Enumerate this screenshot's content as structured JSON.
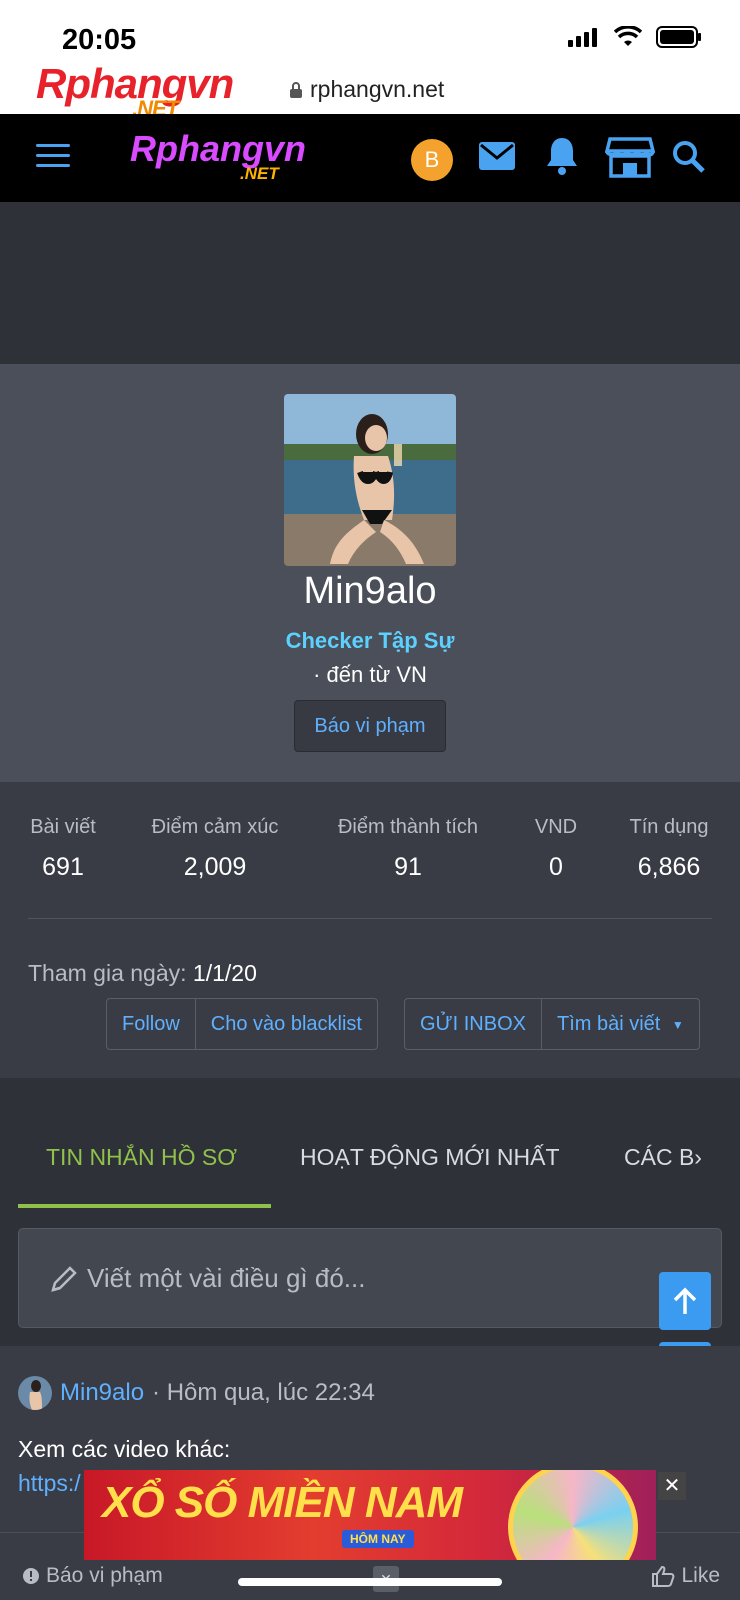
{
  "status_bar": {
    "time": "20:05"
  },
  "browser": {
    "site_logo": "Rphangvn",
    "site_logo_suffix": ".NET",
    "url": "rphangvn.net"
  },
  "navbar": {
    "logo": "Rphangvn",
    "logo_suffix": ".NET",
    "coin_letter": "B"
  },
  "profile": {
    "username": "Min9alo",
    "title": "Checker Tập Sự",
    "location": "· đến từ VN",
    "report_label": "Báo vi phạm"
  },
  "stats": [
    {
      "label": "Bài viết",
      "value": "691"
    },
    {
      "label": "Điểm cảm xúc",
      "value": "2,009"
    },
    {
      "label": "Điểm thành tích",
      "value": "91"
    },
    {
      "label": "VND",
      "value": "0"
    },
    {
      "label": "Tín dụng",
      "value": "6,866"
    }
  ],
  "joined": {
    "label": "Tham gia ngày:",
    "value": "1/1/20"
  },
  "actions": {
    "follow": "Follow",
    "blacklist": "Cho vào blacklist",
    "inbox": "GỬI INBOX",
    "find_posts": "Tìm bài viết"
  },
  "tabs": [
    {
      "label": "TIN NHẮN HỒ SƠ",
      "active": true
    },
    {
      "label": "HOẠT ĐỘNG MỚI NHẤT",
      "active": false
    },
    {
      "label": "CÁC B",
      "active": false
    }
  ],
  "composer": {
    "placeholder": "Viết một vài điều gì đó..."
  },
  "post": {
    "author": "Min9alo",
    "time": "· Hôm qua, lúc 22:34",
    "text": "Xem các video khác:",
    "link": "https:/",
    "report": "Báo vi phạm",
    "like": "Like"
  },
  "ad": {
    "headline": "XỔ SỐ MIỀN NAM",
    "sub": "HÔM NAY"
  },
  "colors": {
    "accent_blue": "#5fb0ff",
    "tab_active": "#8fc14b",
    "title_cyan": "#5cd1ff",
    "coin": "#f4a12d"
  }
}
